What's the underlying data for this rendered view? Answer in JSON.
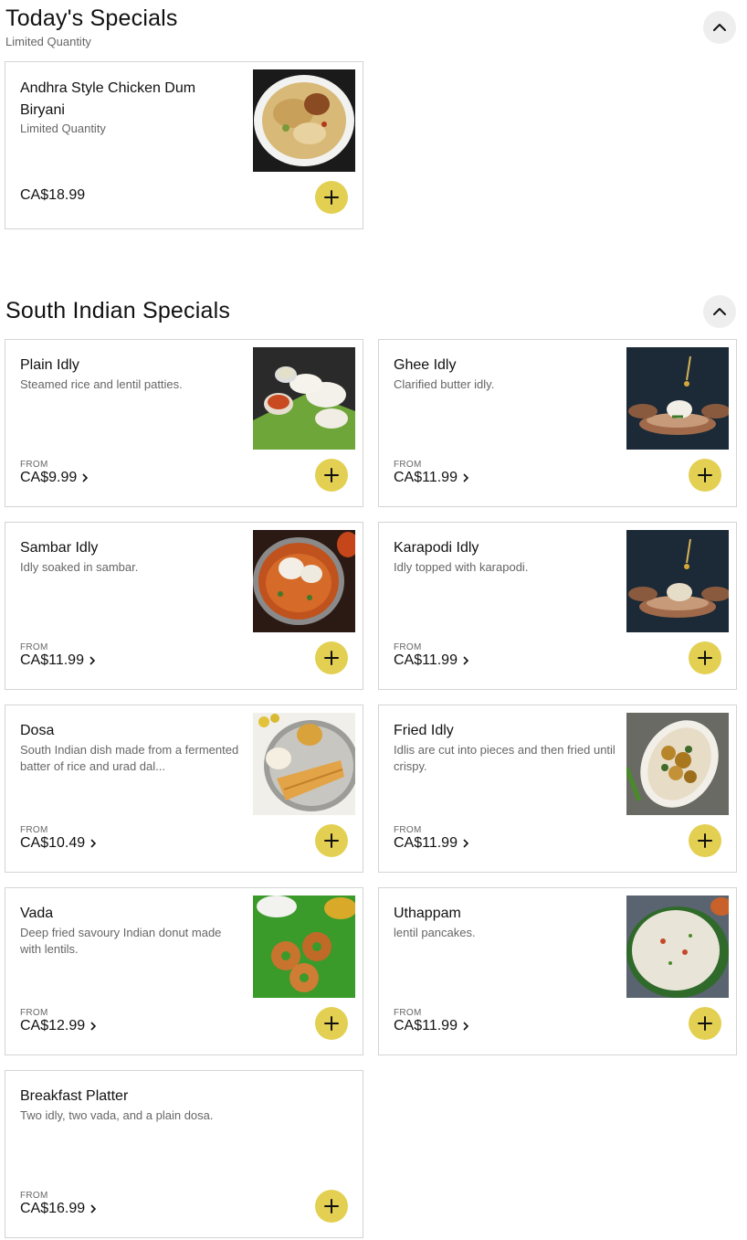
{
  "todays_specials": {
    "title": "Today's Specials",
    "subtitle": "Limited Quantity",
    "items": [
      {
        "name": "Andhra Style Chicken Dum Biryani",
        "description": "Limited Quantity",
        "price": "CA$18.99"
      }
    ]
  },
  "south_indian_specials": {
    "title": "South Indian Specials",
    "items": [
      {
        "name": "Plain Idly",
        "description": "Steamed rice and lentil patties.",
        "from": "FROM",
        "price": "CA$9.99"
      },
      {
        "name": "Ghee Idly",
        "description": "Clarified butter idly.",
        "from": "FROM",
        "price": "CA$11.99"
      },
      {
        "name": "Sambar Idly",
        "description": "Idly soaked in sambar.",
        "from": "FROM",
        "price": "CA$11.99"
      },
      {
        "name": "Karapodi Idly",
        "description": "Idly topped with karapodi.",
        "from": "FROM",
        "price": "CA$11.99"
      },
      {
        "name": "Dosa",
        "description": "South Indian dish made from a fermented batter of rice and urad dal...",
        "from": "FROM",
        "price": "CA$10.49"
      },
      {
        "name": "Fried Idly",
        "description": "Idlis are cut into pieces and then fried until crispy.",
        "from": "FROM",
        "price": "CA$11.99"
      },
      {
        "name": "Vada",
        "description": "Deep fried savoury Indian donut made with lentils.",
        "from": "FROM",
        "price": "CA$12.99"
      },
      {
        "name": "Uthappam",
        "description": "lentil pancakes.",
        "from": "FROM",
        "price": "CA$11.99"
      },
      {
        "name": "Breakfast Platter",
        "description": "Two idly, two vada, and a plain dosa.",
        "from": "FROM",
        "price": "CA$16.99"
      }
    ]
  },
  "icons": {
    "collapse": "chevron-up-icon",
    "add": "plus-icon",
    "price_arrow": "chevron-right-icon"
  },
  "colors": {
    "add_button": "#e3d052",
    "collapse_button": "#eeeeee",
    "card_border": "#d4d4d4"
  }
}
